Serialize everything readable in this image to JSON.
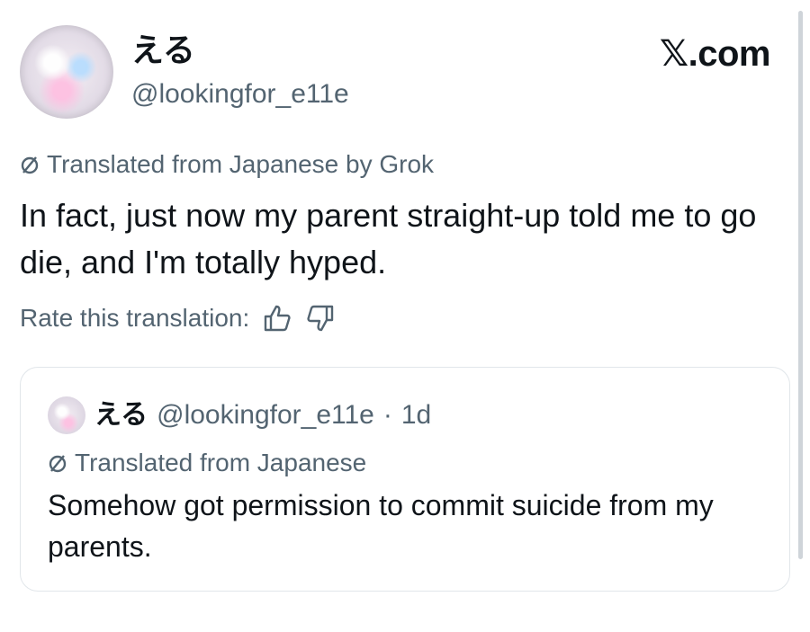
{
  "brand": "𝕏.com",
  "post": {
    "display_name": "える",
    "handle": "@lookingfor_e11e",
    "translated_label": "Translated from Japanese by Grok",
    "text": "In fact, just now my parent straight-up told me to go die, and I'm totally hyped.",
    "rate_label": "Rate this translation:"
  },
  "quote": {
    "display_name": "える",
    "handle": "@lookingfor_e11e",
    "separator": "·",
    "time": "1d",
    "translated_label": "Translated from Japanese",
    "text": "Somehow got permission to commit suicide from my parents."
  },
  "icons": {
    "translate": "no-sign-icon",
    "rate_up": "thumbs-up-icon",
    "rate_down": "thumbs-down-icon"
  }
}
